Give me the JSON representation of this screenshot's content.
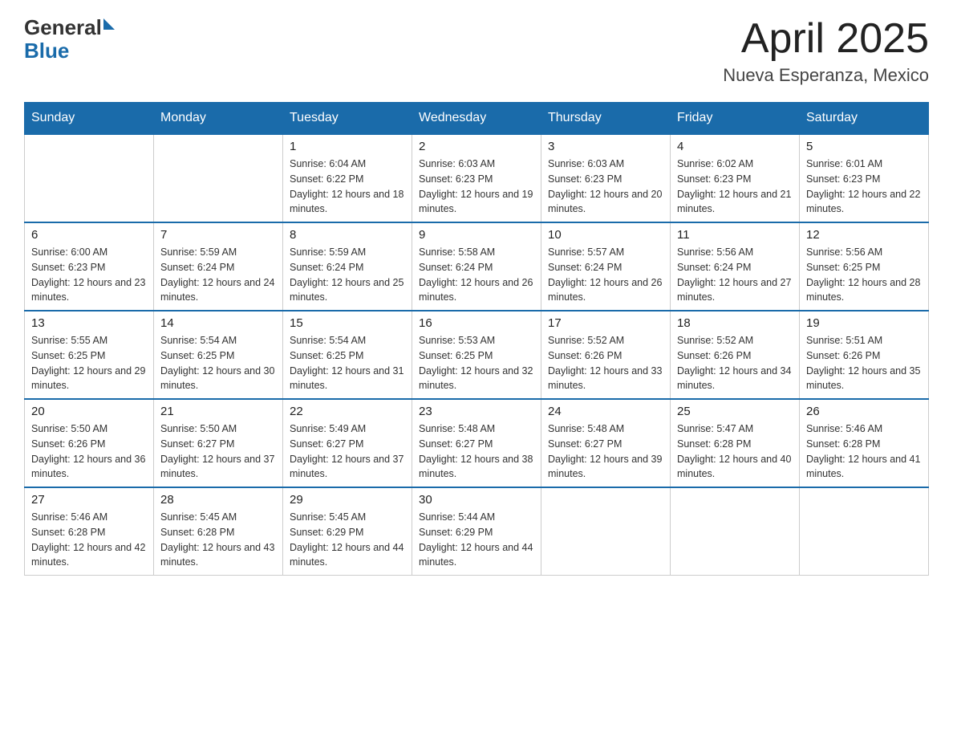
{
  "header": {
    "logo": {
      "general": "General",
      "blue": "Blue"
    },
    "title": "April 2025",
    "subtitle": "Nueva Esperanza, Mexico"
  },
  "calendar": {
    "days_of_week": [
      "Sunday",
      "Monday",
      "Tuesday",
      "Wednesday",
      "Thursday",
      "Friday",
      "Saturday"
    ],
    "weeks": [
      [
        {
          "day": "",
          "sunrise": "",
          "sunset": "",
          "daylight": ""
        },
        {
          "day": "",
          "sunrise": "",
          "sunset": "",
          "daylight": ""
        },
        {
          "day": "1",
          "sunrise": "Sunrise: 6:04 AM",
          "sunset": "Sunset: 6:22 PM",
          "daylight": "Daylight: 12 hours and 18 minutes."
        },
        {
          "day": "2",
          "sunrise": "Sunrise: 6:03 AM",
          "sunset": "Sunset: 6:23 PM",
          "daylight": "Daylight: 12 hours and 19 minutes."
        },
        {
          "day": "3",
          "sunrise": "Sunrise: 6:03 AM",
          "sunset": "Sunset: 6:23 PM",
          "daylight": "Daylight: 12 hours and 20 minutes."
        },
        {
          "day": "4",
          "sunrise": "Sunrise: 6:02 AM",
          "sunset": "Sunset: 6:23 PM",
          "daylight": "Daylight: 12 hours and 21 minutes."
        },
        {
          "day": "5",
          "sunrise": "Sunrise: 6:01 AM",
          "sunset": "Sunset: 6:23 PM",
          "daylight": "Daylight: 12 hours and 22 minutes."
        }
      ],
      [
        {
          "day": "6",
          "sunrise": "Sunrise: 6:00 AM",
          "sunset": "Sunset: 6:23 PM",
          "daylight": "Daylight: 12 hours and 23 minutes."
        },
        {
          "day": "7",
          "sunrise": "Sunrise: 5:59 AM",
          "sunset": "Sunset: 6:24 PM",
          "daylight": "Daylight: 12 hours and 24 minutes."
        },
        {
          "day": "8",
          "sunrise": "Sunrise: 5:59 AM",
          "sunset": "Sunset: 6:24 PM",
          "daylight": "Daylight: 12 hours and 25 minutes."
        },
        {
          "day": "9",
          "sunrise": "Sunrise: 5:58 AM",
          "sunset": "Sunset: 6:24 PM",
          "daylight": "Daylight: 12 hours and 26 minutes."
        },
        {
          "day": "10",
          "sunrise": "Sunrise: 5:57 AM",
          "sunset": "Sunset: 6:24 PM",
          "daylight": "Daylight: 12 hours and 26 minutes."
        },
        {
          "day": "11",
          "sunrise": "Sunrise: 5:56 AM",
          "sunset": "Sunset: 6:24 PM",
          "daylight": "Daylight: 12 hours and 27 minutes."
        },
        {
          "day": "12",
          "sunrise": "Sunrise: 5:56 AM",
          "sunset": "Sunset: 6:25 PM",
          "daylight": "Daylight: 12 hours and 28 minutes."
        }
      ],
      [
        {
          "day": "13",
          "sunrise": "Sunrise: 5:55 AM",
          "sunset": "Sunset: 6:25 PM",
          "daylight": "Daylight: 12 hours and 29 minutes."
        },
        {
          "day": "14",
          "sunrise": "Sunrise: 5:54 AM",
          "sunset": "Sunset: 6:25 PM",
          "daylight": "Daylight: 12 hours and 30 minutes."
        },
        {
          "day": "15",
          "sunrise": "Sunrise: 5:54 AM",
          "sunset": "Sunset: 6:25 PM",
          "daylight": "Daylight: 12 hours and 31 minutes."
        },
        {
          "day": "16",
          "sunrise": "Sunrise: 5:53 AM",
          "sunset": "Sunset: 6:25 PM",
          "daylight": "Daylight: 12 hours and 32 minutes."
        },
        {
          "day": "17",
          "sunrise": "Sunrise: 5:52 AM",
          "sunset": "Sunset: 6:26 PM",
          "daylight": "Daylight: 12 hours and 33 minutes."
        },
        {
          "day": "18",
          "sunrise": "Sunrise: 5:52 AM",
          "sunset": "Sunset: 6:26 PM",
          "daylight": "Daylight: 12 hours and 34 minutes."
        },
        {
          "day": "19",
          "sunrise": "Sunrise: 5:51 AM",
          "sunset": "Sunset: 6:26 PM",
          "daylight": "Daylight: 12 hours and 35 minutes."
        }
      ],
      [
        {
          "day": "20",
          "sunrise": "Sunrise: 5:50 AM",
          "sunset": "Sunset: 6:26 PM",
          "daylight": "Daylight: 12 hours and 36 minutes."
        },
        {
          "day": "21",
          "sunrise": "Sunrise: 5:50 AM",
          "sunset": "Sunset: 6:27 PM",
          "daylight": "Daylight: 12 hours and 37 minutes."
        },
        {
          "day": "22",
          "sunrise": "Sunrise: 5:49 AM",
          "sunset": "Sunset: 6:27 PM",
          "daylight": "Daylight: 12 hours and 37 minutes."
        },
        {
          "day": "23",
          "sunrise": "Sunrise: 5:48 AM",
          "sunset": "Sunset: 6:27 PM",
          "daylight": "Daylight: 12 hours and 38 minutes."
        },
        {
          "day": "24",
          "sunrise": "Sunrise: 5:48 AM",
          "sunset": "Sunset: 6:27 PM",
          "daylight": "Daylight: 12 hours and 39 minutes."
        },
        {
          "day": "25",
          "sunrise": "Sunrise: 5:47 AM",
          "sunset": "Sunset: 6:28 PM",
          "daylight": "Daylight: 12 hours and 40 minutes."
        },
        {
          "day": "26",
          "sunrise": "Sunrise: 5:46 AM",
          "sunset": "Sunset: 6:28 PM",
          "daylight": "Daylight: 12 hours and 41 minutes."
        }
      ],
      [
        {
          "day": "27",
          "sunrise": "Sunrise: 5:46 AM",
          "sunset": "Sunset: 6:28 PM",
          "daylight": "Daylight: 12 hours and 42 minutes."
        },
        {
          "day": "28",
          "sunrise": "Sunrise: 5:45 AM",
          "sunset": "Sunset: 6:28 PM",
          "daylight": "Daylight: 12 hours and 43 minutes."
        },
        {
          "day": "29",
          "sunrise": "Sunrise: 5:45 AM",
          "sunset": "Sunset: 6:29 PM",
          "daylight": "Daylight: 12 hours and 44 minutes."
        },
        {
          "day": "30",
          "sunrise": "Sunrise: 5:44 AM",
          "sunset": "Sunset: 6:29 PM",
          "daylight": "Daylight: 12 hours and 44 minutes."
        },
        {
          "day": "",
          "sunrise": "",
          "sunset": "",
          "daylight": ""
        },
        {
          "day": "",
          "sunrise": "",
          "sunset": "",
          "daylight": ""
        },
        {
          "day": "",
          "sunrise": "",
          "sunset": "",
          "daylight": ""
        }
      ]
    ]
  }
}
